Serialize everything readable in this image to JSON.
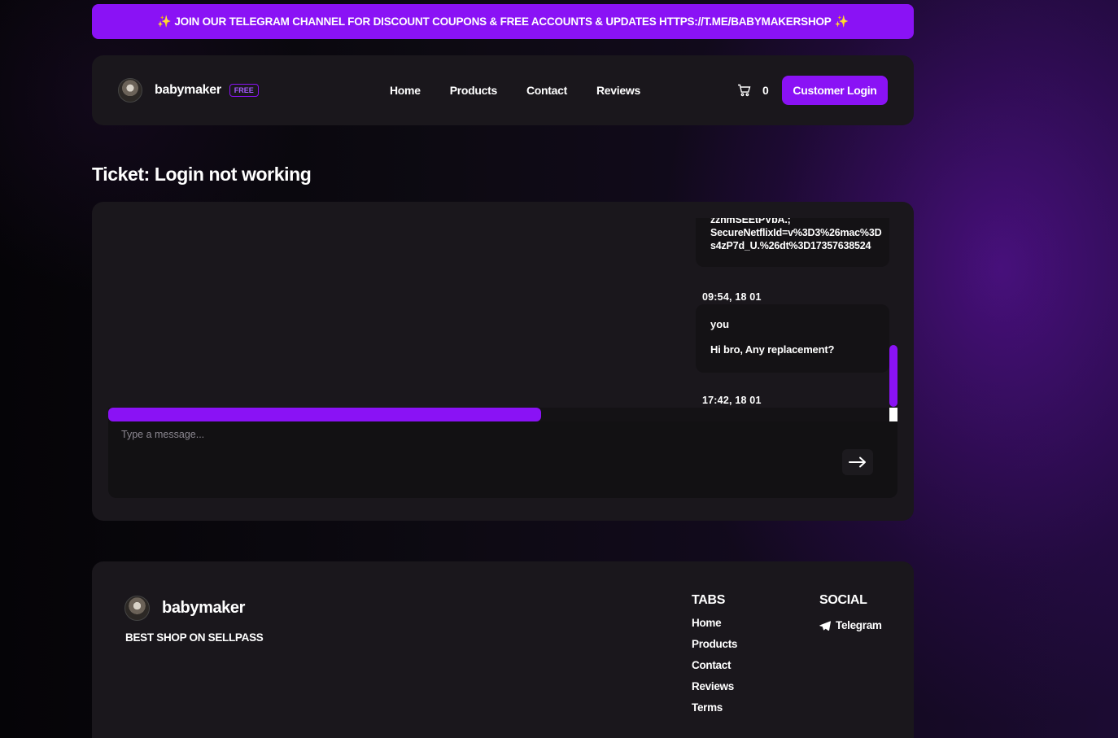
{
  "banner": {
    "text": "JOIN OUR TELEGRAM CHANNEL FOR DISCOUNT COUPONS & FREE ACCOUNTS & UPDATES HTTPS://T.ME/BABYMAKERSHOP",
    "icon_left": "sparkle-icon",
    "icon_right": "sparkle-icon"
  },
  "navbar": {
    "brand": "babymaker",
    "badge": "FREE",
    "links": [
      "Home",
      "Products",
      "Contact",
      "Reviews"
    ],
    "cart_count": "0",
    "login_label": "Customer Login"
  },
  "page": {
    "title": "Ticket: Login not working"
  },
  "chat": {
    "messages": [
      {
        "body_lines": [
          "zznmSEEtPVbA.;",
          "SecureNetflixId=v%3D3%26mac%3D",
          "s4zP7d_U.%26dt%3D17357638524"
        ],
        "timestamp": "09:54, 18 01"
      },
      {
        "sender": "you",
        "text": "Hi bro, Any replacement?",
        "timestamp": "17:42, 18 01"
      }
    ],
    "input_placeholder": "Type a message..."
  },
  "footer": {
    "brand": "babymaker",
    "tagline": "BEST SHOP ON SELLPASS",
    "tabs_heading": "TABS",
    "tabs": [
      "Home",
      "Products",
      "Contact",
      "Reviews",
      "Terms"
    ],
    "social_heading": "SOCIAL",
    "social_links": [
      "Telegram"
    ]
  },
  "colors": {
    "accent": "#8a12f5",
    "card": "#1a171c",
    "inner": "#141215"
  }
}
